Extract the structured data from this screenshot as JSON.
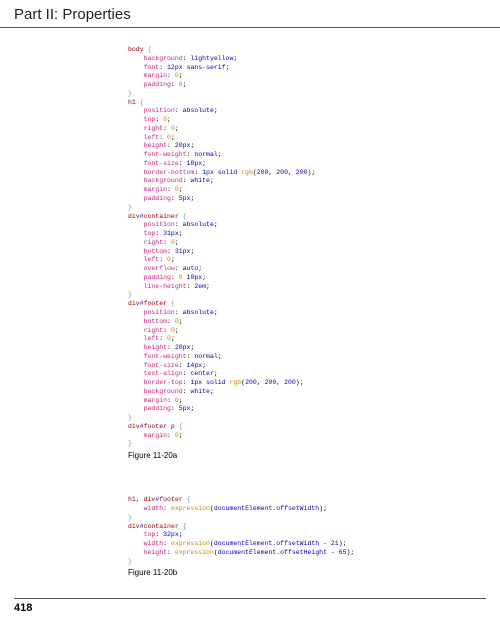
{
  "header": {
    "title": "Part II: Properties"
  },
  "page_number": "418",
  "figures": {
    "a": {
      "caption": "Figure 11-20a"
    },
    "b": {
      "caption": "Figure 11-20b"
    }
  },
  "code_a": {
    "lines": [
      [
        [
          "kw",
          "body "
        ],
        [
          "br",
          "{"
        ]
      ],
      [
        [
          "sp",
          "    "
        ],
        [
          "prop",
          "background"
        ],
        [
          "punc",
          ": "
        ],
        [
          "num",
          "lightyellow"
        ],
        [
          "punc",
          ";"
        ]
      ],
      [
        [
          "sp",
          "    "
        ],
        [
          "prop",
          "font"
        ],
        [
          "punc",
          ": "
        ],
        [
          "num",
          "12px"
        ],
        [
          "punc",
          " "
        ],
        [
          "num",
          "sans-serif"
        ],
        [
          "punc",
          ";"
        ]
      ],
      [
        [
          "sp",
          "    "
        ],
        [
          "prop",
          "margin"
        ],
        [
          "punc",
          ": "
        ],
        [
          "zero",
          "0"
        ],
        [
          "punc",
          ";"
        ]
      ],
      [
        [
          "sp",
          "    "
        ],
        [
          "prop",
          "padding"
        ],
        [
          "punc",
          ": "
        ],
        [
          "zero",
          "0"
        ],
        [
          "punc",
          ";"
        ]
      ],
      [
        [
          "br",
          "}"
        ]
      ],
      [
        [
          "kw",
          "h1 "
        ],
        [
          "br",
          "{"
        ]
      ],
      [
        [
          "sp",
          "    "
        ],
        [
          "prop",
          "position"
        ],
        [
          "punc",
          ": "
        ],
        [
          "num",
          "absolute"
        ],
        [
          "punc",
          ";"
        ]
      ],
      [
        [
          "sp",
          "    "
        ],
        [
          "prop",
          "top"
        ],
        [
          "punc",
          ": "
        ],
        [
          "zero",
          "0"
        ],
        [
          "punc",
          ";"
        ]
      ],
      [
        [
          "sp",
          "    "
        ],
        [
          "prop",
          "right"
        ],
        [
          "punc",
          ": "
        ],
        [
          "zero",
          "0"
        ],
        [
          "punc",
          ";"
        ]
      ],
      [
        [
          "sp",
          "    "
        ],
        [
          "prop",
          "left"
        ],
        [
          "punc",
          ": "
        ],
        [
          "zero",
          "0"
        ],
        [
          "punc",
          ";"
        ]
      ],
      [
        [
          "sp",
          "    "
        ],
        [
          "prop",
          "height"
        ],
        [
          "punc",
          ": "
        ],
        [
          "num",
          "20px"
        ],
        [
          "punc",
          ";"
        ]
      ],
      [
        [
          "sp",
          "    "
        ],
        [
          "prop",
          "font-weight"
        ],
        [
          "punc",
          ": "
        ],
        [
          "num",
          "normal"
        ],
        [
          "punc",
          ";"
        ]
      ],
      [
        [
          "sp",
          "    "
        ],
        [
          "prop",
          "font-size"
        ],
        [
          "punc",
          ": "
        ],
        [
          "num",
          "18px"
        ],
        [
          "punc",
          ";"
        ]
      ],
      [
        [
          "sp",
          "    "
        ],
        [
          "prop",
          "border-bottom"
        ],
        [
          "punc",
          ": "
        ],
        [
          "num",
          "1px solid "
        ],
        [
          "fn",
          "rgb"
        ],
        [
          "punc",
          "("
        ],
        [
          "num",
          "200"
        ],
        [
          "punc",
          ", "
        ],
        [
          "num",
          "200"
        ],
        [
          "punc",
          ", "
        ],
        [
          "num",
          "200"
        ],
        [
          "punc",
          ");"
        ]
      ],
      [
        [
          "sp",
          "    "
        ],
        [
          "prop",
          "background"
        ],
        [
          "punc",
          ": "
        ],
        [
          "num",
          "white"
        ],
        [
          "punc",
          ";"
        ]
      ],
      [
        [
          "sp",
          "    "
        ],
        [
          "prop",
          "margin"
        ],
        [
          "punc",
          ": "
        ],
        [
          "zero",
          "0"
        ],
        [
          "punc",
          ";"
        ]
      ],
      [
        [
          "sp",
          "    "
        ],
        [
          "prop",
          "padding"
        ],
        [
          "punc",
          ": "
        ],
        [
          "num",
          "5px"
        ],
        [
          "punc",
          ";"
        ]
      ],
      [
        [
          "br",
          "}"
        ]
      ],
      [
        [
          "kw",
          "div"
        ],
        [
          "col",
          "#"
        ],
        [
          "kw",
          "container "
        ],
        [
          "br",
          "{"
        ]
      ],
      [
        [
          "sp",
          "    "
        ],
        [
          "prop",
          "position"
        ],
        [
          "punc",
          ": "
        ],
        [
          "num",
          "absolute"
        ],
        [
          "punc",
          ";"
        ]
      ],
      [
        [
          "sp",
          "    "
        ],
        [
          "prop",
          "top"
        ],
        [
          "punc",
          ": "
        ],
        [
          "num",
          "31px"
        ],
        [
          "punc",
          ";"
        ]
      ],
      [
        [
          "sp",
          "    "
        ],
        [
          "prop",
          "right"
        ],
        [
          "punc",
          ": "
        ],
        [
          "zero",
          "0"
        ],
        [
          "punc",
          ";"
        ]
      ],
      [
        [
          "sp",
          "    "
        ],
        [
          "prop",
          "bottom"
        ],
        [
          "punc",
          ": "
        ],
        [
          "num",
          "31px"
        ],
        [
          "punc",
          ";"
        ]
      ],
      [
        [
          "sp",
          "    "
        ],
        [
          "prop",
          "left"
        ],
        [
          "punc",
          ": "
        ],
        [
          "zero",
          "0"
        ],
        [
          "punc",
          ";"
        ]
      ],
      [
        [
          "sp",
          "    "
        ],
        [
          "prop",
          "overflow"
        ],
        [
          "punc",
          ": "
        ],
        [
          "num",
          "auto"
        ],
        [
          "punc",
          ";"
        ]
      ],
      [
        [
          "sp",
          "    "
        ],
        [
          "prop",
          "padding"
        ],
        [
          "punc",
          ": "
        ],
        [
          "zero",
          "0"
        ],
        [
          "punc",
          " "
        ],
        [
          "num",
          "10px"
        ],
        [
          "punc",
          ";"
        ]
      ],
      [
        [
          "sp",
          "    "
        ],
        [
          "prop",
          "line-height"
        ],
        [
          "punc",
          ": "
        ],
        [
          "num",
          "2em"
        ],
        [
          "punc",
          ";"
        ]
      ],
      [
        [
          "br",
          "}"
        ]
      ],
      [
        [
          "kw",
          "div"
        ],
        [
          "col",
          "#"
        ],
        [
          "kw",
          "footer "
        ],
        [
          "br",
          "{"
        ]
      ],
      [
        [
          "sp",
          "    "
        ],
        [
          "prop",
          "position"
        ],
        [
          "punc",
          ": "
        ],
        [
          "num",
          "absolute"
        ],
        [
          "punc",
          ";"
        ]
      ],
      [
        [
          "sp",
          "    "
        ],
        [
          "prop",
          "bottom"
        ],
        [
          "punc",
          ": "
        ],
        [
          "zero",
          "0"
        ],
        [
          "punc",
          ";"
        ]
      ],
      [
        [
          "sp",
          "    "
        ],
        [
          "prop",
          "right"
        ],
        [
          "punc",
          ": "
        ],
        [
          "zero",
          "0"
        ],
        [
          "punc",
          ";"
        ]
      ],
      [
        [
          "sp",
          "    "
        ],
        [
          "prop",
          "left"
        ],
        [
          "punc",
          ": "
        ],
        [
          "zero",
          "0"
        ],
        [
          "punc",
          ";"
        ]
      ],
      [
        [
          "sp",
          "    "
        ],
        [
          "prop",
          "height"
        ],
        [
          "punc",
          ": "
        ],
        [
          "num",
          "20px"
        ],
        [
          "punc",
          ";"
        ]
      ],
      [
        [
          "sp",
          "    "
        ],
        [
          "prop",
          "font-weight"
        ],
        [
          "punc",
          ": "
        ],
        [
          "num",
          "normal"
        ],
        [
          "punc",
          ";"
        ]
      ],
      [
        [
          "sp",
          "    "
        ],
        [
          "prop",
          "font-size"
        ],
        [
          "punc",
          ": "
        ],
        [
          "num",
          "14px"
        ],
        [
          "punc",
          ";"
        ]
      ],
      [
        [
          "sp",
          "    "
        ],
        [
          "prop",
          "text-align"
        ],
        [
          "punc",
          ": "
        ],
        [
          "num",
          "center"
        ],
        [
          "punc",
          ";"
        ]
      ],
      [
        [
          "sp",
          "    "
        ],
        [
          "prop",
          "border-top"
        ],
        [
          "punc",
          ": "
        ],
        [
          "num",
          "1px solid "
        ],
        [
          "fn",
          "rgb"
        ],
        [
          "punc",
          "("
        ],
        [
          "num",
          "200"
        ],
        [
          "punc",
          ", "
        ],
        [
          "num",
          "200"
        ],
        [
          "punc",
          ", "
        ],
        [
          "num",
          "200"
        ],
        [
          "punc",
          ");"
        ]
      ],
      [
        [
          "sp",
          "    "
        ],
        [
          "prop",
          "background"
        ],
        [
          "punc",
          ": "
        ],
        [
          "num",
          "white"
        ],
        [
          "punc",
          ";"
        ]
      ],
      [
        [
          "sp",
          "    "
        ],
        [
          "prop",
          "margin"
        ],
        [
          "punc",
          ": "
        ],
        [
          "zero",
          "0"
        ],
        [
          "punc",
          ";"
        ]
      ],
      [
        [
          "sp",
          "    "
        ],
        [
          "prop",
          "padding"
        ],
        [
          "punc",
          ": "
        ],
        [
          "num",
          "5px"
        ],
        [
          "punc",
          ";"
        ]
      ],
      [
        [
          "br",
          "}"
        ]
      ],
      [
        [
          "kw",
          "div"
        ],
        [
          "col",
          "#"
        ],
        [
          "kw",
          "footer p "
        ],
        [
          "br",
          "{"
        ]
      ],
      [
        [
          "sp",
          "    "
        ],
        [
          "prop",
          "margin"
        ],
        [
          "punc",
          ": "
        ],
        [
          "zero",
          "0"
        ],
        [
          "punc",
          ";"
        ]
      ],
      [
        [
          "br",
          "}"
        ]
      ]
    ]
  },
  "code_b": {
    "lines": [
      [
        [
          "kw",
          "h1"
        ],
        [
          "punc",
          ", "
        ],
        [
          "kw",
          "div"
        ],
        [
          "col",
          "#"
        ],
        [
          "kw",
          "footer "
        ],
        [
          "br",
          "{"
        ]
      ],
      [
        [
          "sp",
          "    "
        ],
        [
          "prop",
          "width"
        ],
        [
          "punc",
          ": "
        ],
        [
          "fn",
          "expression"
        ],
        [
          "punc",
          "("
        ],
        [
          "num",
          "documentElement.offsetWidth"
        ],
        [
          "punc",
          ");"
        ]
      ],
      [
        [
          "br",
          "}"
        ]
      ],
      [
        [
          "kw",
          "div"
        ],
        [
          "col",
          "#"
        ],
        [
          "kw",
          "container "
        ],
        [
          "br",
          "{"
        ]
      ],
      [
        [
          "sp",
          "    "
        ],
        [
          "prop",
          "top"
        ],
        [
          "punc",
          ": "
        ],
        [
          "num",
          "32px"
        ],
        [
          "punc",
          ";"
        ]
      ],
      [
        [
          "sp",
          "    "
        ],
        [
          "prop",
          "width"
        ],
        [
          "punc",
          ": "
        ],
        [
          "fn",
          "expression"
        ],
        [
          "punc",
          "("
        ],
        [
          "num",
          "documentElement.offsetWidth - 21"
        ],
        [
          "punc",
          ");"
        ]
      ],
      [
        [
          "sp",
          "    "
        ],
        [
          "prop",
          "height"
        ],
        [
          "punc",
          ": "
        ],
        [
          "fn",
          "expression"
        ],
        [
          "punc",
          "("
        ],
        [
          "num",
          "documentElement.offsetHeight - 65"
        ],
        [
          "punc",
          ");"
        ]
      ],
      [
        [
          "br",
          "}"
        ]
      ]
    ]
  }
}
